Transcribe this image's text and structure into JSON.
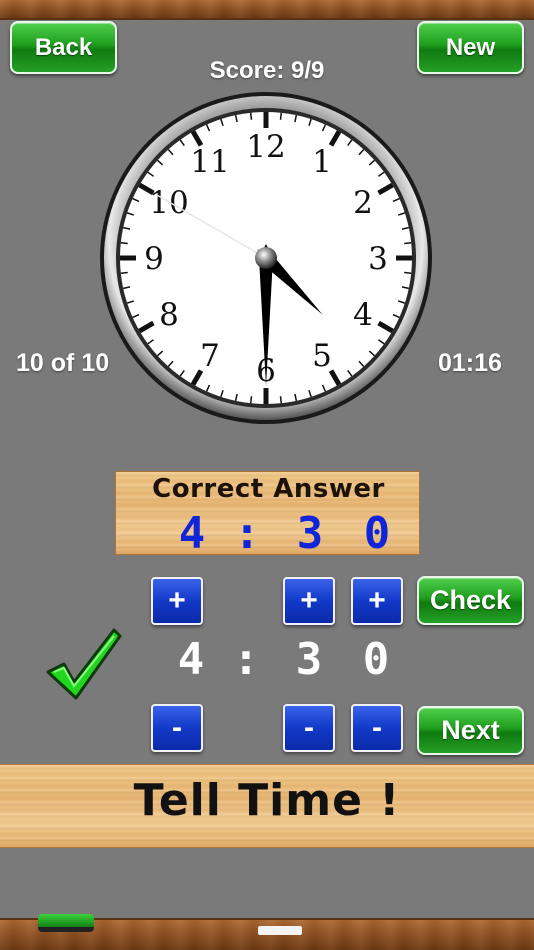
{
  "header": {
    "back_label": "Back",
    "new_label": "New",
    "score": "Score: 9/9"
  },
  "progress": {
    "question": "10 of 10",
    "timer": "01:16"
  },
  "clock": {
    "numerals": [
      "12",
      "1",
      "2",
      "3",
      "4",
      "5",
      "6",
      "7",
      "8",
      "9",
      "10",
      "11"
    ],
    "hour": 4,
    "minute": 30,
    "second": 50
  },
  "correct_answer": {
    "title": "Correct Answer",
    "hour": "4",
    "separator": ":",
    "minute_tens": "3",
    "minute_ones": "0"
  },
  "entry": {
    "hour": "4",
    "separator": ":",
    "minute_tens": "3",
    "minute_ones": "0"
  },
  "controls": {
    "plus": "+",
    "minus": "-",
    "check_label": "Check",
    "next_label": "Next"
  },
  "result": {
    "icon": "checkmark-icon",
    "status": "correct",
    "color": "#22d61e"
  },
  "footer": {
    "title": "Tell Time !"
  }
}
